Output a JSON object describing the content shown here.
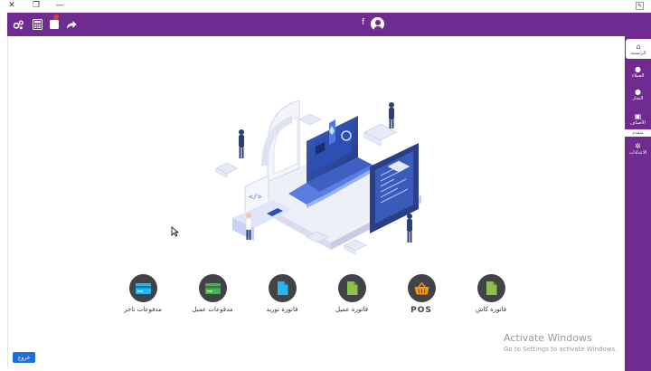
{
  "titlebar": {
    "close_glyph": "✕",
    "restore_glyph": "❐",
    "minimize_glyph": "—"
  },
  "header": {
    "icons": [
      "settings-icon",
      "calculator-icon",
      "notes-icon",
      "share-icon"
    ],
    "user_letter": "f"
  },
  "sidebar": {
    "items": [
      {
        "label": "الرئيسية",
        "icon": "home-icon"
      },
      {
        "label": "العملاء",
        "icon": "person-icon"
      },
      {
        "label": "التجار",
        "icon": "person-icon"
      },
      {
        "label": "الأصناف",
        "icon": "items-icon"
      },
      {
        "label": "الاعدادات",
        "icon": "settings-icon"
      }
    ],
    "tag": "متقدم"
  },
  "actions": [
    {
      "label": "فاتورة كاش",
      "icon": "file-icon",
      "color": "#8bc34a"
    },
    {
      "label": "POS",
      "icon": "basket-icon",
      "color": "#ff9800"
    },
    {
      "label": "فاتورة عميل",
      "icon": "file-icon",
      "color": "#8bc34a"
    },
    {
      "label": "فاتورة توريد",
      "icon": "file-icon",
      "color": "#29b6f6"
    },
    {
      "label": "مدفوعات عميل",
      "icon": "card-icon",
      "color": "#4caf50"
    },
    {
      "label": "مدفوعات تاجر",
      "icon": "card-icon",
      "color": "#29b6f6"
    }
  ],
  "logout_label": "خروج",
  "watermark": {
    "title": "Activate Windows",
    "subtitle": "Go to Settings to activate Windows."
  },
  "colors": {
    "brand": "#6f2b8f",
    "icon_bg": "#424348",
    "logout": "#1e6fd9"
  }
}
